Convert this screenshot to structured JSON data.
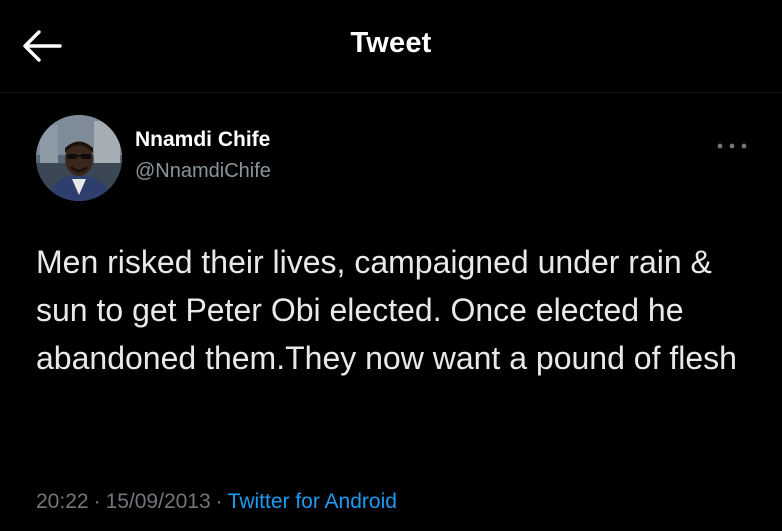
{
  "header": {
    "title": "Tweet",
    "back_icon": "arrow-left-icon"
  },
  "tweet": {
    "author": {
      "display_name": "Nnamdi Chife",
      "handle": "@NnamdiChife",
      "avatar": "profile-photo"
    },
    "more_icon": "more-horizontal-icon",
    "text": "Men risked their lives, campaigned under rain & sun to get Peter Obi elected. Once elected he abandoned them.They now want a pound of flesh",
    "time": "20:22",
    "separator": "·",
    "date": "15/09/2013",
    "source": "Twitter for Android"
  },
  "colors": {
    "background": "#000000",
    "text_primary": "#e7e9ea",
    "text_secondary": "#71767b",
    "link": "#1d9bf0"
  }
}
